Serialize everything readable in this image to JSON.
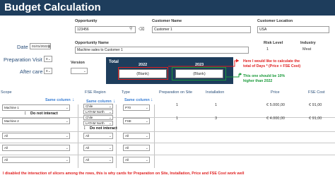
{
  "title": "Budget Calculation",
  "opportunity": {
    "label": "Opportunity",
    "value": "123456",
    "name_label": "Opportunity Name",
    "name_value": "Machine sales to Customer 1"
  },
  "customer_name": {
    "label": "Customer Name",
    "value": "Customer 1"
  },
  "customer_location": {
    "label": "Customer Location",
    "value": "USA"
  },
  "risk_level": {
    "label": "Risk Level",
    "value": "1"
  },
  "industry": {
    "label": "Industry",
    "value": "Meat"
  },
  "date": {
    "label": "Date",
    "value": "01/01/2022"
  },
  "preparation_visit": {
    "label": "Preparation Visit",
    "value": "0"
  },
  "after_care": {
    "label": "After care",
    "value": "0"
  },
  "version": {
    "label": "Version"
  },
  "total": {
    "label": "Total",
    "year1": "2022",
    "year2": "2023",
    "blank1": "(Blank)",
    "blank2": "(Blank)"
  },
  "annotations": {
    "red_note_1": "Here I would like to calculate the",
    "red_note_2": "total of Days * (Price + FSE Cost)",
    "green_note_1": "This one should be 10%",
    "green_note_2": "higher than 2022",
    "same_column_1": "Same column",
    "same_column_2": "Same column",
    "same_column_3": "Same column",
    "do_not_interact_1": "Do not interact",
    "do_not_interact_2": "Do not interact",
    "bottom_note": "I disabled the interaction of slicers among the rows, this is why cards for Preparation on Site, Installation, Price and FSE Cost work well"
  },
  "columns": {
    "scope": "Scope",
    "fse_region": "FSE Region",
    "type": "Type",
    "prep_on_site": "Preparation on Site",
    "installation": "Installation",
    "price": "Price",
    "fse_cost": "FSE Cost"
  },
  "rows": [
    {
      "scope": "Machine 1",
      "region_1": "Chile",
      "region_2": "LATAM North",
      "type": "P70",
      "prep": "1",
      "install": "1",
      "price": "€ 5.000,00",
      "fse": "€ 91,00"
    },
    {
      "scope": "Machine 2",
      "region_1": "Chile",
      "region_2": "LATAM North",
      "type": "FSE",
      "prep": "1",
      "install": "3",
      "price": "€ 4.000,00",
      "fse": "€ 91,00"
    },
    {
      "scope": "All",
      "region": "All",
      "type": "All"
    },
    {
      "scope": "All",
      "region": "All",
      "type": "All"
    },
    {
      "scope": "All",
      "region": "All",
      "type": "All"
    }
  ]
}
